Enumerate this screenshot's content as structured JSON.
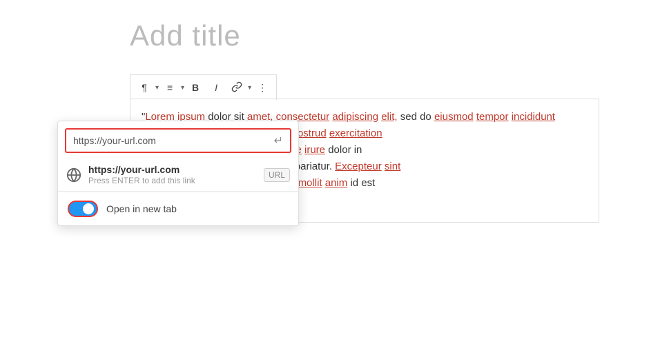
{
  "title": {
    "placeholder": "Add title"
  },
  "toolbar": {
    "paragraph_label": "¶",
    "align_label": "≡",
    "bold_label": "B",
    "italic_label": "I",
    "link_label": "🔗",
    "more_label": "⋮"
  },
  "content": {
    "text": "\"Lorem ipsum dolor sit amet, consectetur adipiscing elit, sed do eiusmod tempor incididunt . Ut enim ad minim veniam, quis nostrud exercitation ea commodo consequat. Duis aute irure dolor in esse cillum dolore eu fugiat nulla pariatur. Excepteur sint . sunt in culpa qui officia deserunt mollit anim id est"
  },
  "link_popup": {
    "input_value": "https://your-url.com",
    "input_placeholder": "https://your-url.com",
    "suggestion_url": "https://your-url.com",
    "suggestion_hint": "Press ENTER to add this link",
    "url_badge": "URL",
    "toggle_label": "Open in new tab"
  }
}
